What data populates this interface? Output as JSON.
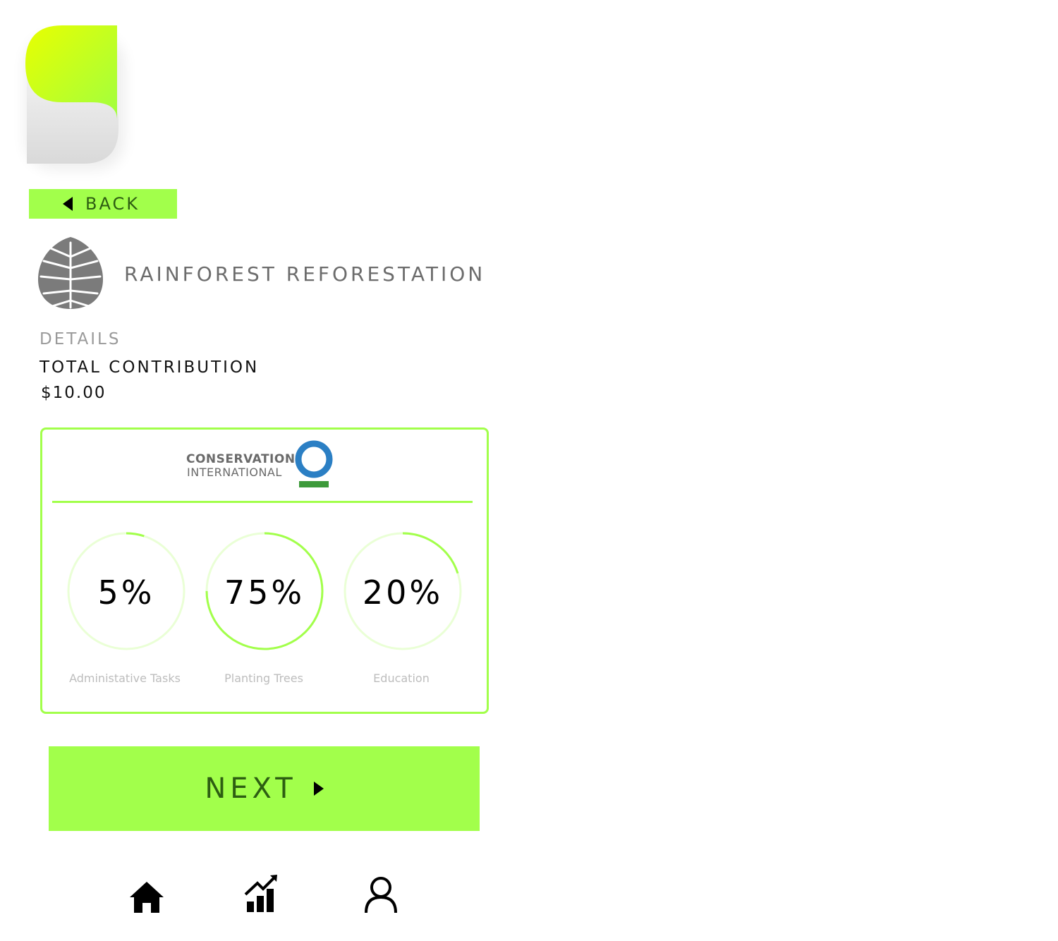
{
  "header": {
    "back_label": "BACK"
  },
  "project": {
    "title": "RAINFOREST REFORESTATION",
    "icon": "leaf-icon"
  },
  "details": {
    "section_label": "DETAILS",
    "total_label": "TOTAL CONTRIBUTION",
    "total_value": "$10.00"
  },
  "organization": {
    "name_line1": "CONSERVATION",
    "name_line2": "INTERNATIONAL",
    "logo_colors": {
      "ring": "#2b7fc4",
      "bar": "#3d9a3a"
    }
  },
  "allocation": [
    {
      "percent": 5,
      "label": "5%",
      "category": "Administative Tasks"
    },
    {
      "percent": 75,
      "label": "75%",
      "category": "Planting Trees"
    },
    {
      "percent": 20,
      "label": "20%",
      "category": "Education"
    }
  ],
  "next_label": "NEXT",
  "bottom_nav": [
    "home-icon",
    "stats-icon",
    "profile-icon"
  ],
  "colors": {
    "accent": "#a2ff4b",
    "accent_text": "#2d5e12",
    "ring_track": "#eaffd6"
  }
}
